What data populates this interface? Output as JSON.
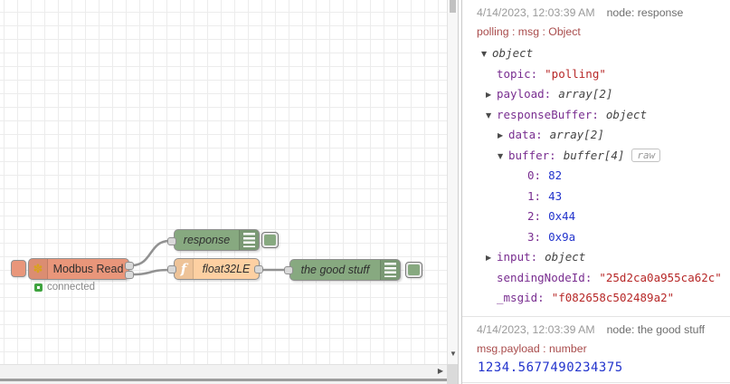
{
  "flow": {
    "modbus": {
      "label": "Modbus Read",
      "icon_glyph": "✽",
      "status": "connected"
    },
    "response_node": {
      "label": "response"
    },
    "function_node": {
      "label": "float32LE",
      "icon_glyph": "f"
    },
    "good_stuff_node": {
      "label": "the good stuff"
    }
  },
  "colors": {
    "modbus_node": "#e9967a",
    "debug_node": "#87a980",
    "function_node": "#fdd0a2",
    "status_connected": "#3fa33f",
    "wire": "#919191",
    "object_key": "#792e90",
    "string_value": "#b72828",
    "number_value": "#2233cc",
    "msg_path_text": "#a94c4c"
  },
  "scrollbars": {
    "down_glyph": "▼",
    "right_glyph": "▶"
  },
  "debug": {
    "messages": [
      {
        "timestamp": "4/14/2023, 12:03:39 AM",
        "source": "node: response",
        "path": "polling : msg : Object",
        "raw_label": "raw",
        "rows": [
          {
            "arrow": "▼",
            "key": "",
            "value": "object"
          },
          {
            "arrow": "",
            "key": "topic:",
            "value": "\"polling\""
          },
          {
            "arrow": "▶",
            "key": "payload:",
            "value": "array[2]"
          },
          {
            "arrow": "▼",
            "key": "responseBuffer:",
            "value": "object"
          },
          {
            "arrow": "▶",
            "key": "data:",
            "value": "array[2]"
          },
          {
            "arrow": "▼",
            "key": "buffer:",
            "value": "buffer[4]"
          },
          {
            "arrow": "",
            "key": "0:",
            "value": "82"
          },
          {
            "arrow": "",
            "key": "1:",
            "value": "43"
          },
          {
            "arrow": "",
            "key": "2:",
            "value": "0x44"
          },
          {
            "arrow": "",
            "key": "3:",
            "value": "0x9a"
          },
          {
            "arrow": "▶",
            "key": "input:",
            "value": "object"
          },
          {
            "arrow": "",
            "key": "sendingNodeId:",
            "value": "\"25d2ca0a955ca62c\""
          },
          {
            "arrow": "",
            "key": "_msgid:",
            "value": "\"f082658c502489a2\""
          }
        ]
      },
      {
        "timestamp": "4/14/2023, 12:03:39 AM",
        "source": "node: the good stuff",
        "path": "msg.payload : number",
        "payload": "1234.5677490234375"
      }
    ]
  }
}
